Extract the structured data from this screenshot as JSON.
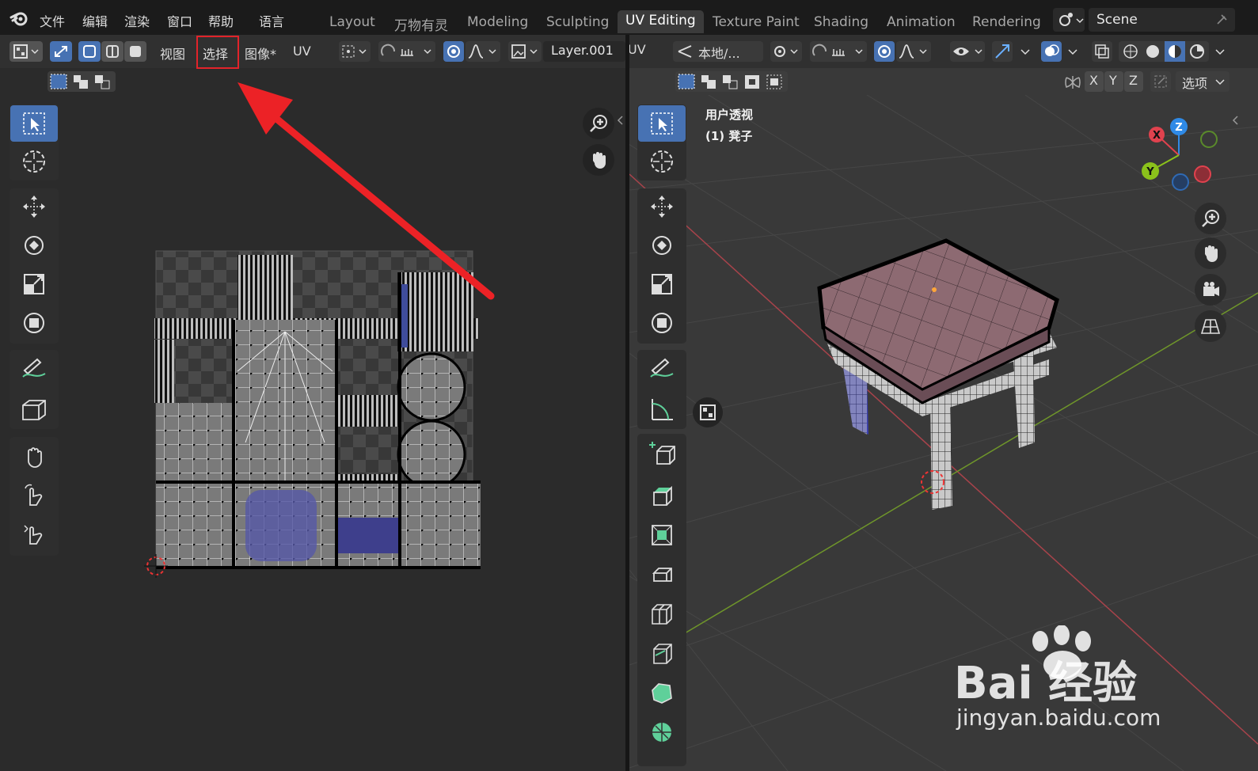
{
  "topbar": {
    "menus": [
      "文件",
      "编辑",
      "渲染",
      "窗口",
      "帮助",
      "语言"
    ],
    "tabs": [
      "Layout",
      "万物有灵",
      "Modeling",
      "Sculpting",
      "UV Editing",
      "Texture Paint",
      "Shading",
      "Animation",
      "Rendering"
    ],
    "active_tab": "UV Editing",
    "scene_label": "Scene"
  },
  "uv_editor": {
    "menus": [
      "视图",
      "选择",
      "图像*",
      "UV"
    ],
    "highlighted_menu": "选择",
    "image_name": "Layer.001"
  },
  "viewport": {
    "header_label": "UV",
    "orientation": "本地/...",
    "axes": [
      "X",
      "Y",
      "Z"
    ],
    "options_label": "选项",
    "view_name": "用户透视",
    "object_name": "(1) 凳子",
    "gizmo": {
      "x": "X",
      "y": "Y",
      "z": "Z"
    }
  },
  "watermark": {
    "brand": "Bai  经验",
    "url": "jingyan.baidu.com"
  },
  "colors": {
    "accent": "#4772b3",
    "annotation": "#e2232a",
    "x_axis": "#e0424e",
    "y_axis": "#8bc21b",
    "z_axis": "#2f8ae6"
  }
}
